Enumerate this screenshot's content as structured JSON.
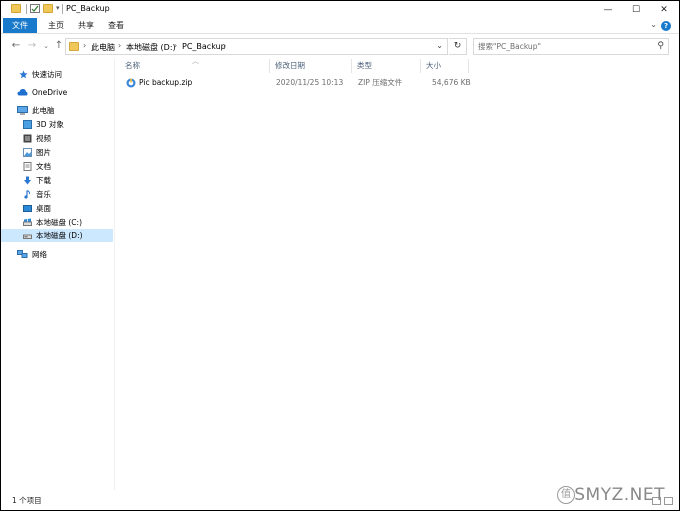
{
  "window": {
    "title": "PC_Backup",
    "controls": {
      "minimize": "—",
      "maximize": "☐",
      "close": "✕"
    }
  },
  "ribbon": {
    "tabs": [
      {
        "label": "文件",
        "active": true
      },
      {
        "label": "主页"
      },
      {
        "label": "共享"
      },
      {
        "label": "查看"
      }
    ],
    "help": "?"
  },
  "address_bar": {
    "breadcrumb": [
      "此电脑",
      "本地磁盘 (D:)",
      "PC_Backup"
    ]
  },
  "search": {
    "placeholder": "搜索\"PC_Backup\""
  },
  "sidebar": {
    "items": [
      {
        "label": "快速访问",
        "icon": "star-icon"
      },
      {
        "label": "OneDrive",
        "icon": "cloud-icon"
      },
      {
        "label": "此电脑",
        "icon": "computer-icon"
      },
      {
        "label": "3D 对象",
        "icon": "cube-icon"
      },
      {
        "label": "视频",
        "icon": "video-icon"
      },
      {
        "label": "图片",
        "icon": "picture-icon"
      },
      {
        "label": "文档",
        "icon": "document-icon"
      },
      {
        "label": "下载",
        "icon": "download-icon"
      },
      {
        "label": "音乐",
        "icon": "music-icon"
      },
      {
        "label": "桌面",
        "icon": "desktop-icon"
      },
      {
        "label": "本地磁盘 (C:)",
        "icon": "drive-icon"
      },
      {
        "label": "本地磁盘 (D:)",
        "icon": "drive-icon",
        "selected": true
      },
      {
        "label": "网络",
        "icon": "network-icon"
      }
    ]
  },
  "file_list": {
    "columns": [
      "名称",
      "修改日期",
      "类型",
      "大小"
    ],
    "rows": [
      {
        "name": "Pic backup.zip",
        "modified": "2020/11/25 10:13",
        "type": "ZIP 压缩文件",
        "size": "54,676 KB",
        "icon": "zip-icon"
      }
    ]
  },
  "status": {
    "item_count": "1 个项目"
  },
  "watermark": {
    "text": "SMYZ.NET",
    "badge": "值"
  },
  "colors": {
    "accent": "#1979ca",
    "selection": "#cce8ff",
    "header_text": "#4c607a"
  }
}
